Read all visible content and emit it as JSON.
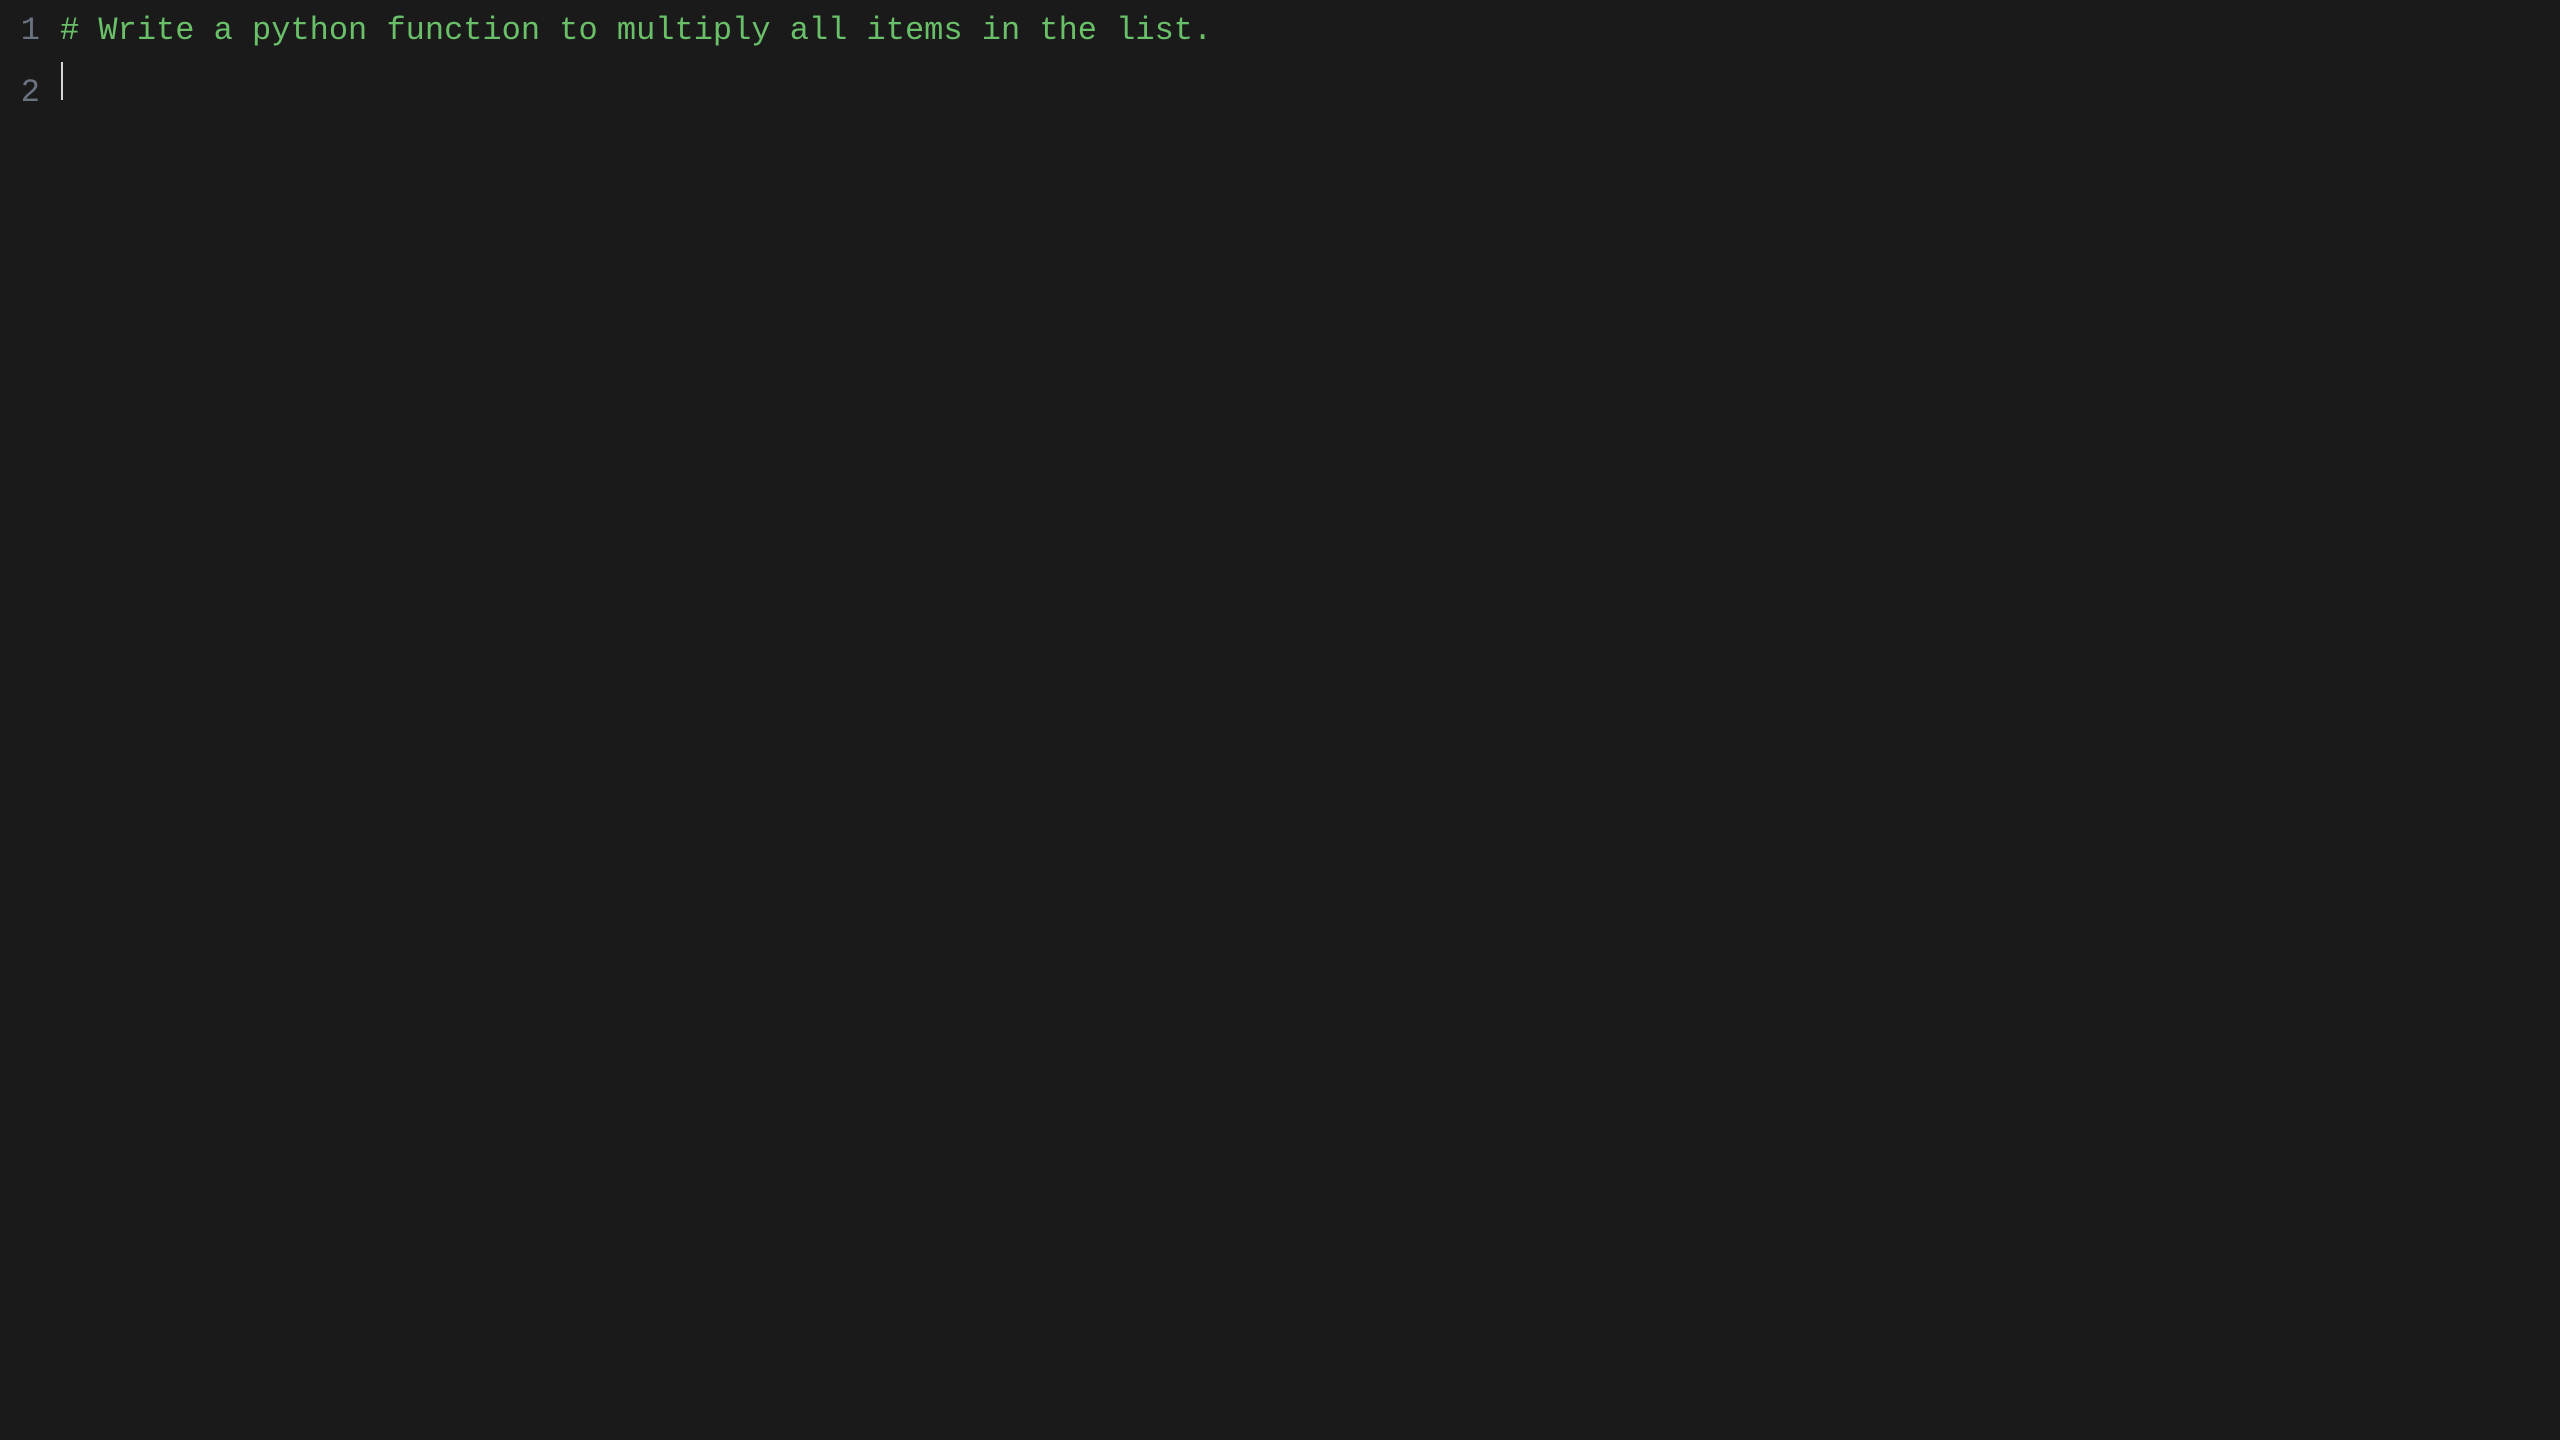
{
  "editor": {
    "background": "#1a1a1a",
    "lines": [
      {
        "number": "1",
        "content": "# Write a python function to multiply all items in the list.",
        "type": "comment"
      },
      {
        "number": "2",
        "content": "",
        "type": "cursor"
      }
    ]
  }
}
